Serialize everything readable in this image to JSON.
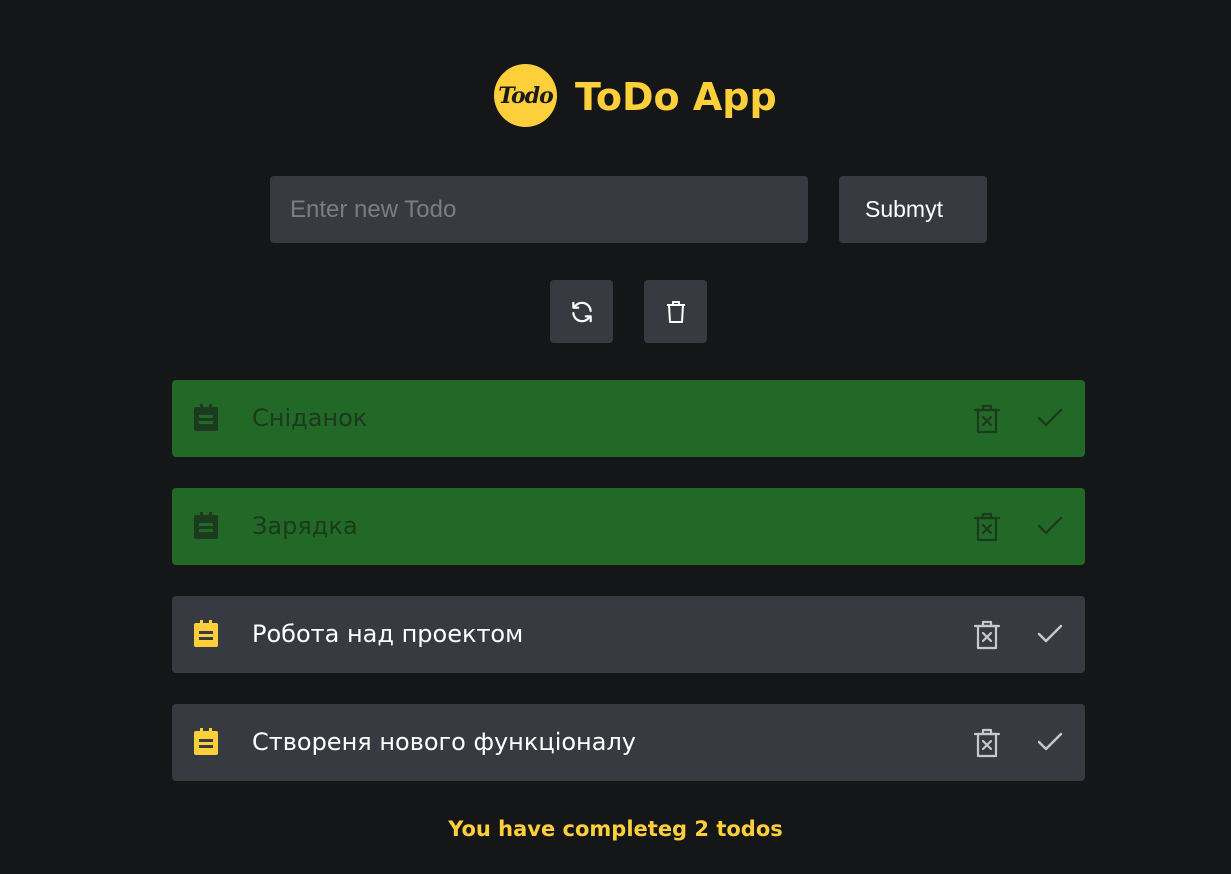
{
  "header": {
    "logo_text": "Todo",
    "title": "ToDo App"
  },
  "form": {
    "input_placeholder": "Enter new Todo",
    "input_value": "",
    "submit_label": "Submyt"
  },
  "toolbar": {
    "refresh_icon": "refresh-icon",
    "clear_icon": "trash-icon"
  },
  "todos": [
    {
      "text": "Сніданок",
      "completed": true
    },
    {
      "text": "Зарядка",
      "completed": true
    },
    {
      "text": "Робота над проектом",
      "completed": false
    },
    {
      "text": "Створеня нового функціоналу",
      "completed": false
    }
  ],
  "footer": {
    "status": "You have completeg 2 todos"
  },
  "colors": {
    "background": "#151618",
    "accent": "#fdd03b",
    "surface": "#383a42",
    "completed": "#226827"
  }
}
